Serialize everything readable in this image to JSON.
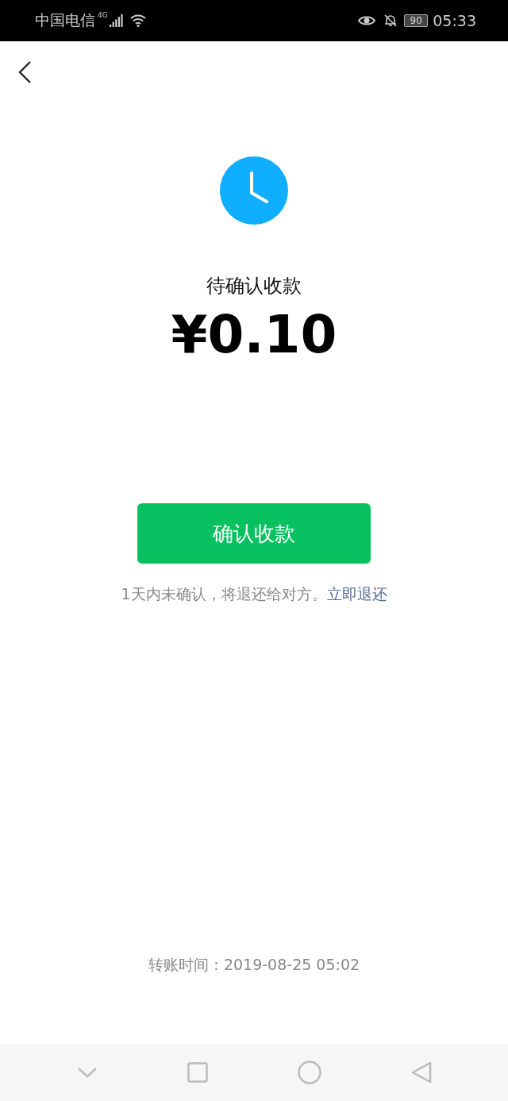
{
  "status_bar": {
    "carrier": "中国电信",
    "network": "4G",
    "battery": "90",
    "time": "05:33"
  },
  "title": "待确认收款",
  "amount": "¥0.10",
  "confirm_button": "确认收款",
  "notice": {
    "text": "1天内未确认，将退还给对方。",
    "link": "立即退还"
  },
  "transfer_time": "转账时间：2019-08-25 05:02"
}
